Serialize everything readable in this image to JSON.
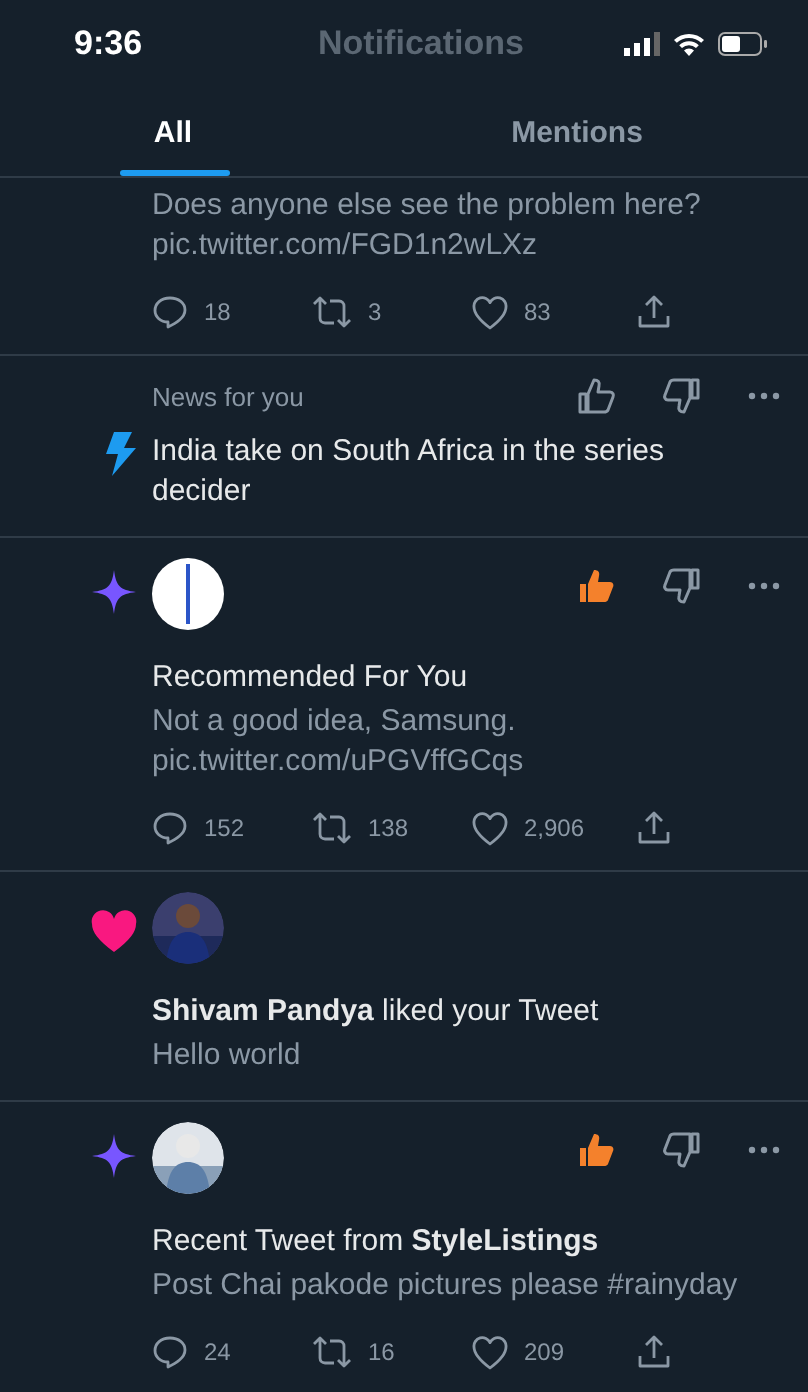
{
  "status_bar": {
    "time": "9:36"
  },
  "header": {
    "title": "Notifications"
  },
  "tabs": [
    {
      "label": "All",
      "selected": true
    },
    {
      "label": "Mentions",
      "selected": false
    }
  ],
  "notifications": [
    {
      "kind": "tweet",
      "text": "Does anyone else see the problem here? pic.twitter.com/FGD1n2wLXz",
      "stats": {
        "replies": "18",
        "retweets": "3",
        "likes": "83"
      }
    },
    {
      "kind": "news",
      "category": "News for you",
      "headline": "India take on South Africa in the series decider",
      "thumbs_up": false
    },
    {
      "kind": "recommended",
      "avatar": {
        "kind": "logo"
      },
      "thumbs_up": true,
      "title": "Recommended For You",
      "text": "Not a good idea, Samsung. pic.twitter.com/uPGVffGCqs",
      "stats": {
        "replies": "152",
        "retweets": "138",
        "likes": "2,906"
      }
    },
    {
      "kind": "like",
      "title": "**Shivam Pandya** liked your Tweet",
      "text": "Hello world"
    },
    {
      "kind": "recommended",
      "thumbs_up": true,
      "title": "Recent Tweet from **StyleListings**",
      "text": "Post Chai pakode pictures please #rainyday",
      "stats": {
        "replies": "24",
        "retweets": "16",
        "likes": "209"
      }
    }
  ]
}
